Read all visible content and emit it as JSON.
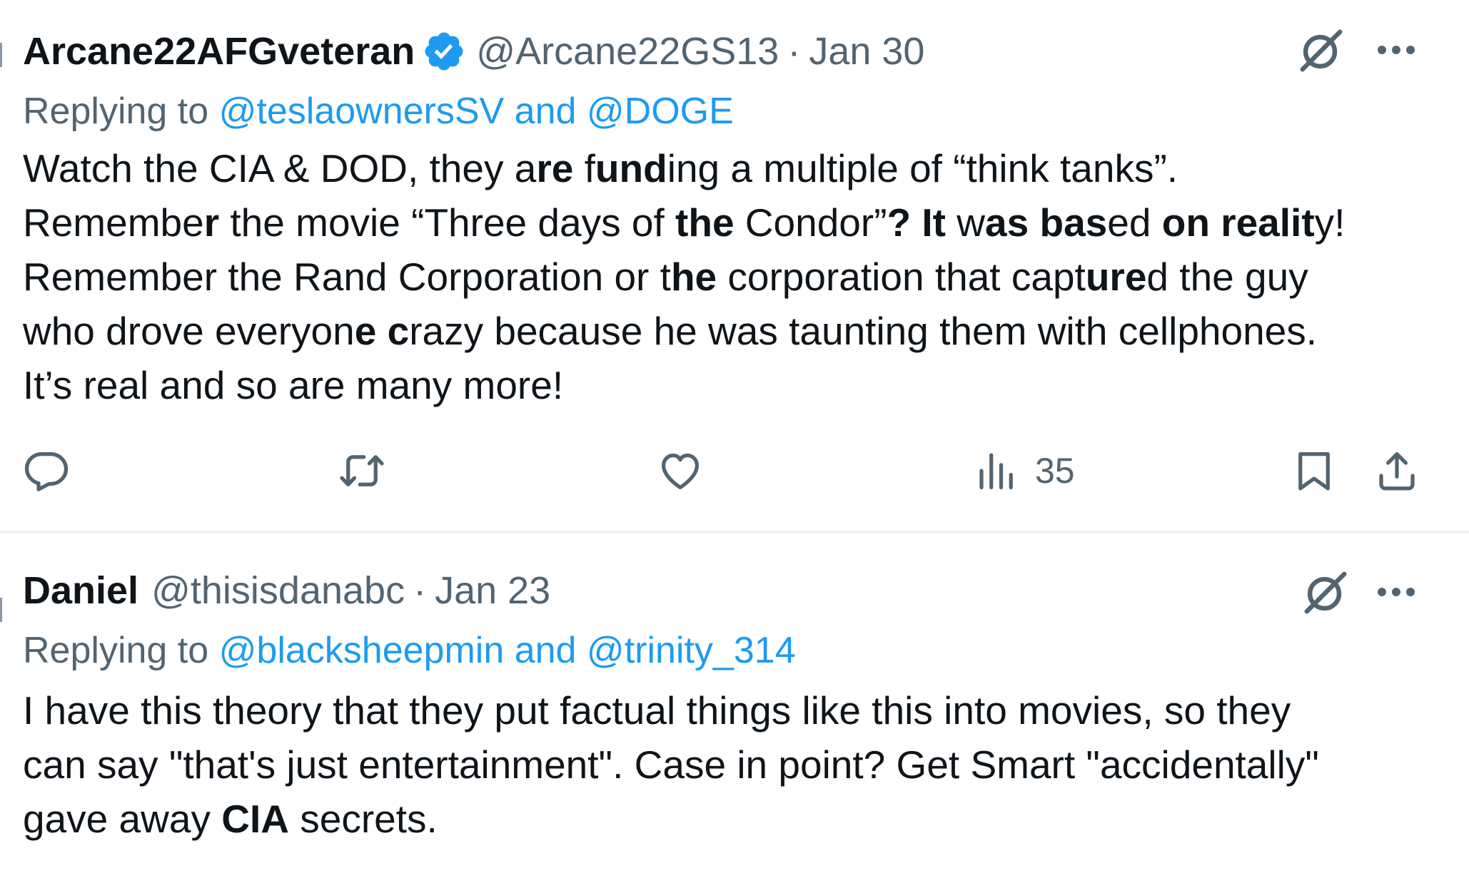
{
  "tweets": [
    {
      "display_name": "Arcane22AFGveteran",
      "handle": "@Arcane22GS13",
      "date": "Jan 30",
      "replying_prefix": "Replying to",
      "replying_to": "@teslaownersSV and @DOGE",
      "lines": [
        [
          {
            "t": "Watch the CIA & DOD, they a"
          },
          {
            "t": "re",
            "b": true
          },
          {
            "t": " f"
          },
          {
            "t": "und",
            "b": true
          },
          {
            "t": "ing a multiple of “think tanks”."
          }
        ],
        [
          {
            "t": "Remembe"
          },
          {
            "t": "r",
            "b": true
          },
          {
            "t": " the movie “Three days of "
          },
          {
            "t": "the",
            "b": true
          },
          {
            "t": " Condor”"
          },
          {
            "t": "? It",
            "b": true
          },
          {
            "t": " w"
          },
          {
            "t": "as",
            "b": true
          },
          {
            "t": " "
          },
          {
            "t": "bas",
            "b": true
          },
          {
            "t": "ed "
          },
          {
            "t": "on realit",
            "b": true
          },
          {
            "t": "y!"
          }
        ],
        [
          {
            "t": "Remember the Rand Corporation or t"
          },
          {
            "t": "he",
            "b": true
          },
          {
            "t": " corporation that capt"
          },
          {
            "t": "ure",
            "b": true
          },
          {
            "t": "d the guy"
          }
        ],
        [
          {
            "t": "who drove everyon"
          },
          {
            "t": "e c",
            "b": true
          },
          {
            "t": "razy because he was taunting them with cellphones."
          }
        ],
        [
          {
            "t": "It’s real and so are many more!"
          }
        ]
      ],
      "views": "35",
      "verified": true
    },
    {
      "display_name": "Daniel",
      "handle": "@thisisdanabc",
      "date": "Jan 23",
      "replying_prefix": "Replying to",
      "replying_to": "@blacksheepmin and @trinity_314",
      "lines": [
        [
          {
            "t": "I have this theory that they put factual things like this into movies, so they"
          }
        ],
        [
          {
            "t": "can say \"that's just entertainment\". Case in point? Get Smart \"accidentally\""
          }
        ],
        [
          {
            "t": "gave away "
          },
          {
            "t": "CIA",
            "b": true
          },
          {
            "t": " secrets."
          }
        ]
      ],
      "verified": false
    }
  ],
  "separator": "·",
  "colors": {
    "accent": "#1d9bf0",
    "secondary_text": "#536471",
    "primary_text": "#0f1419",
    "divider": "#eff3f4"
  },
  "icons": [
    "verified-badge-icon",
    "grok-icon",
    "more-icon",
    "reply-icon",
    "retweet-icon",
    "like-icon",
    "views-icon",
    "bookmark-icon",
    "share-icon"
  ]
}
